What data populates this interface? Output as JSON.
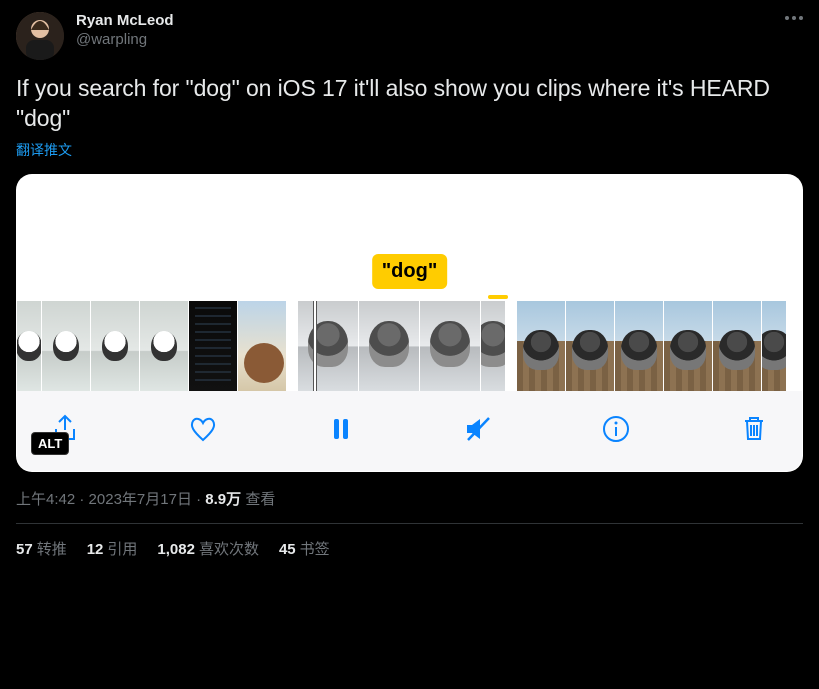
{
  "author": {
    "display_name": "Ryan McLeod",
    "handle": "@warpling"
  },
  "tweet_text": "If you search for \"dog\" on iOS 17 it'll also show you clips where it's HEARD \"dog\"",
  "translate_label": "翻译推文",
  "media": {
    "chip_text": "\"dog\"",
    "alt_badge": "ALT"
  },
  "meta": {
    "time": "上午4:42",
    "date": "2023年7月17日",
    "views_count": "8.9万",
    "views_label": "查看"
  },
  "stats": {
    "retweets": {
      "count": "57",
      "label": "转推"
    },
    "quotes": {
      "count": "12",
      "label": "引用"
    },
    "likes": {
      "count": "1,082",
      "label": "喜欢次数"
    },
    "bookmarks": {
      "count": "45",
      "label": "书签"
    }
  }
}
